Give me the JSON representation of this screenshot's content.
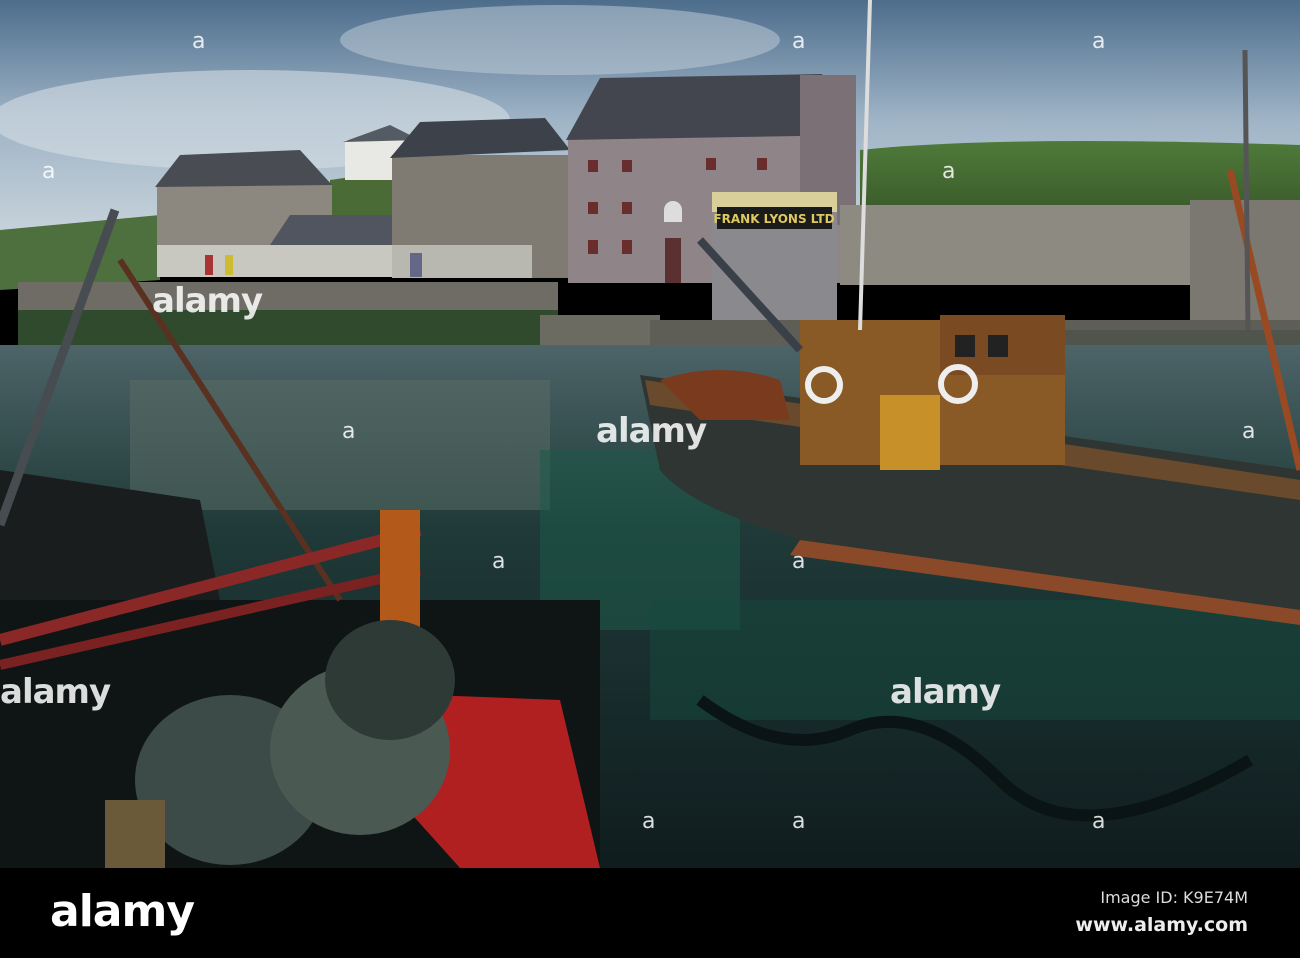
{
  "photo": {
    "building_sign": "FRANK LYONS LTD",
    "watermark": "alamy",
    "marker": "a"
  },
  "footer": {
    "logo": "alamy",
    "image_id": "Image ID: K9E74M",
    "website": "www.alamy.com"
  }
}
